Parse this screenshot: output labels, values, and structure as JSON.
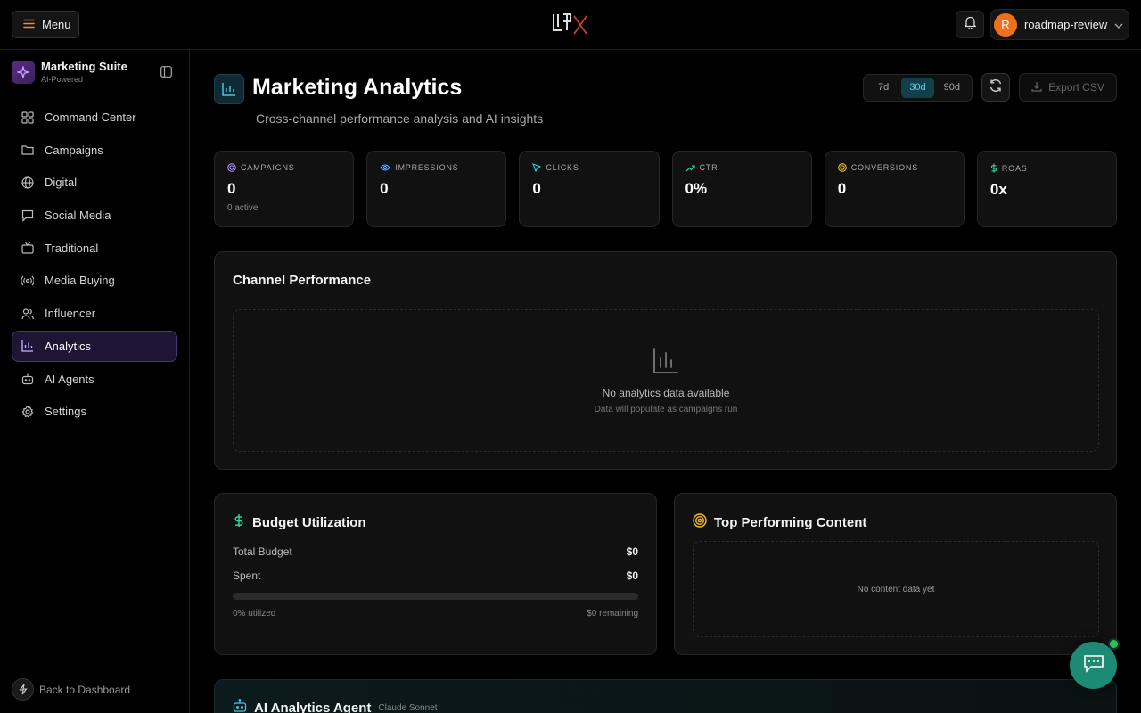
{
  "topbar": {
    "menu_label": "Menu",
    "user_initial": "R",
    "user_name": "roadmap-review"
  },
  "sidebar": {
    "brand_title": "Marketing Suite",
    "brand_sub": "AI-Powered",
    "items": [
      {
        "label": "Command Center",
        "icon": "grid-icon"
      },
      {
        "label": "Campaigns",
        "icon": "folder-icon"
      },
      {
        "label": "Digital",
        "icon": "globe-icon"
      },
      {
        "label": "Social Media",
        "icon": "message-icon"
      },
      {
        "label": "Traditional",
        "icon": "tv-icon"
      },
      {
        "label": "Media Buying",
        "icon": "radio-icon"
      },
      {
        "label": "Influencer",
        "icon": "users-icon"
      },
      {
        "label": "Analytics",
        "icon": "bar-chart-icon",
        "active": true
      },
      {
        "label": "AI Agents",
        "icon": "bot-icon"
      },
      {
        "label": "Settings",
        "icon": "gear-icon"
      }
    ],
    "back_label": "Back to Dashboard"
  },
  "header": {
    "title": "Marketing Analytics",
    "subtitle": "Cross-channel performance analysis and AI insights",
    "ranges": [
      "7d",
      "30d",
      "90d"
    ],
    "selected_range": "30d",
    "export_label": "Export CSV"
  },
  "stats": [
    {
      "label": "CAMPAIGNS",
      "value": "0",
      "sub": "0 active",
      "color": "#a78bfa"
    },
    {
      "label": "IMPRESSIONS",
      "value": "0",
      "sub": "",
      "color": "#60a5fa"
    },
    {
      "label": "CLICKS",
      "value": "0",
      "sub": "",
      "color": "#22d3ee"
    },
    {
      "label": "CTR",
      "value": "0%",
      "sub": "",
      "color": "#34d399"
    },
    {
      "label": "CONVERSIONS",
      "value": "0",
      "sub": "",
      "color": "#fbbf24"
    },
    {
      "label": "ROAS",
      "value": "0x",
      "sub": "",
      "color": "#34d399"
    }
  ],
  "channel": {
    "title": "Channel Performance",
    "empty_title": "No analytics data available",
    "empty_sub": "Data will populate as campaigns run"
  },
  "budget": {
    "title": "Budget Utilization",
    "total_label": "Total Budget",
    "total_value": "$0",
    "spent_label": "Spent",
    "spent_value": "$0",
    "utilized_pct": 0,
    "utilized_label": "0% utilized",
    "remaining_label": "$0 remaining"
  },
  "top_content": {
    "title": "Top Performing Content",
    "empty": "No content data yet"
  },
  "agent": {
    "title": "AI Analytics Agent",
    "model": "Claude Sonnet"
  }
}
